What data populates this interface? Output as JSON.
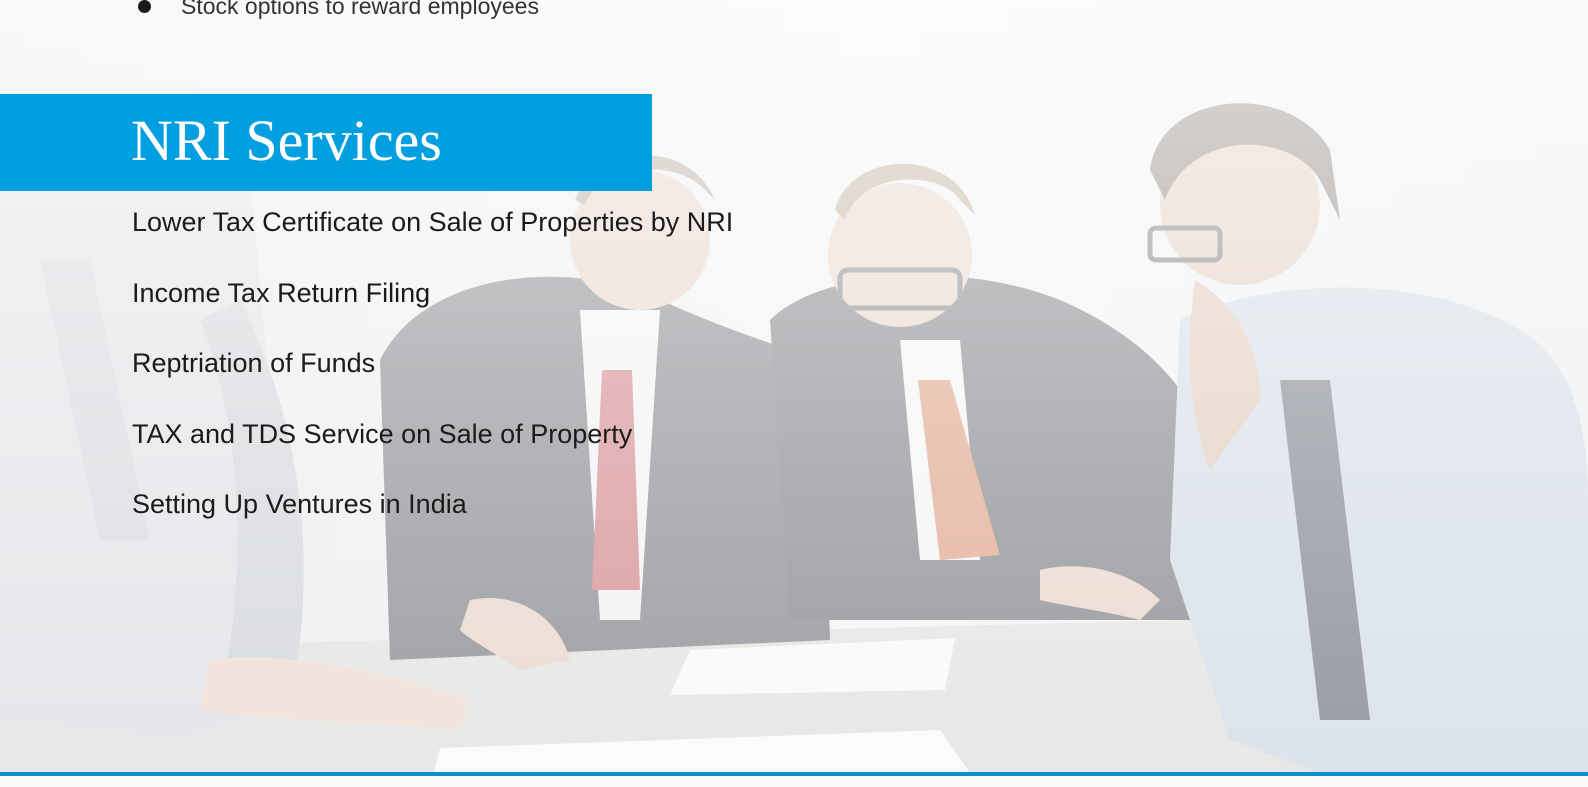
{
  "top_bullet": {
    "text": "Stock options to reward employees"
  },
  "section": {
    "title": "NRI Services",
    "accent_color": "#019fe0",
    "items": [
      "Lower Tax Certificate on Sale of Properties by NRI",
      "Income Tax Return Filing",
      "Reptriation of Funds",
      "TAX and TDS Service on Sale of Property",
      "Setting Up Ventures in India"
    ]
  },
  "background": {
    "icon": "business-meeting-photo"
  }
}
